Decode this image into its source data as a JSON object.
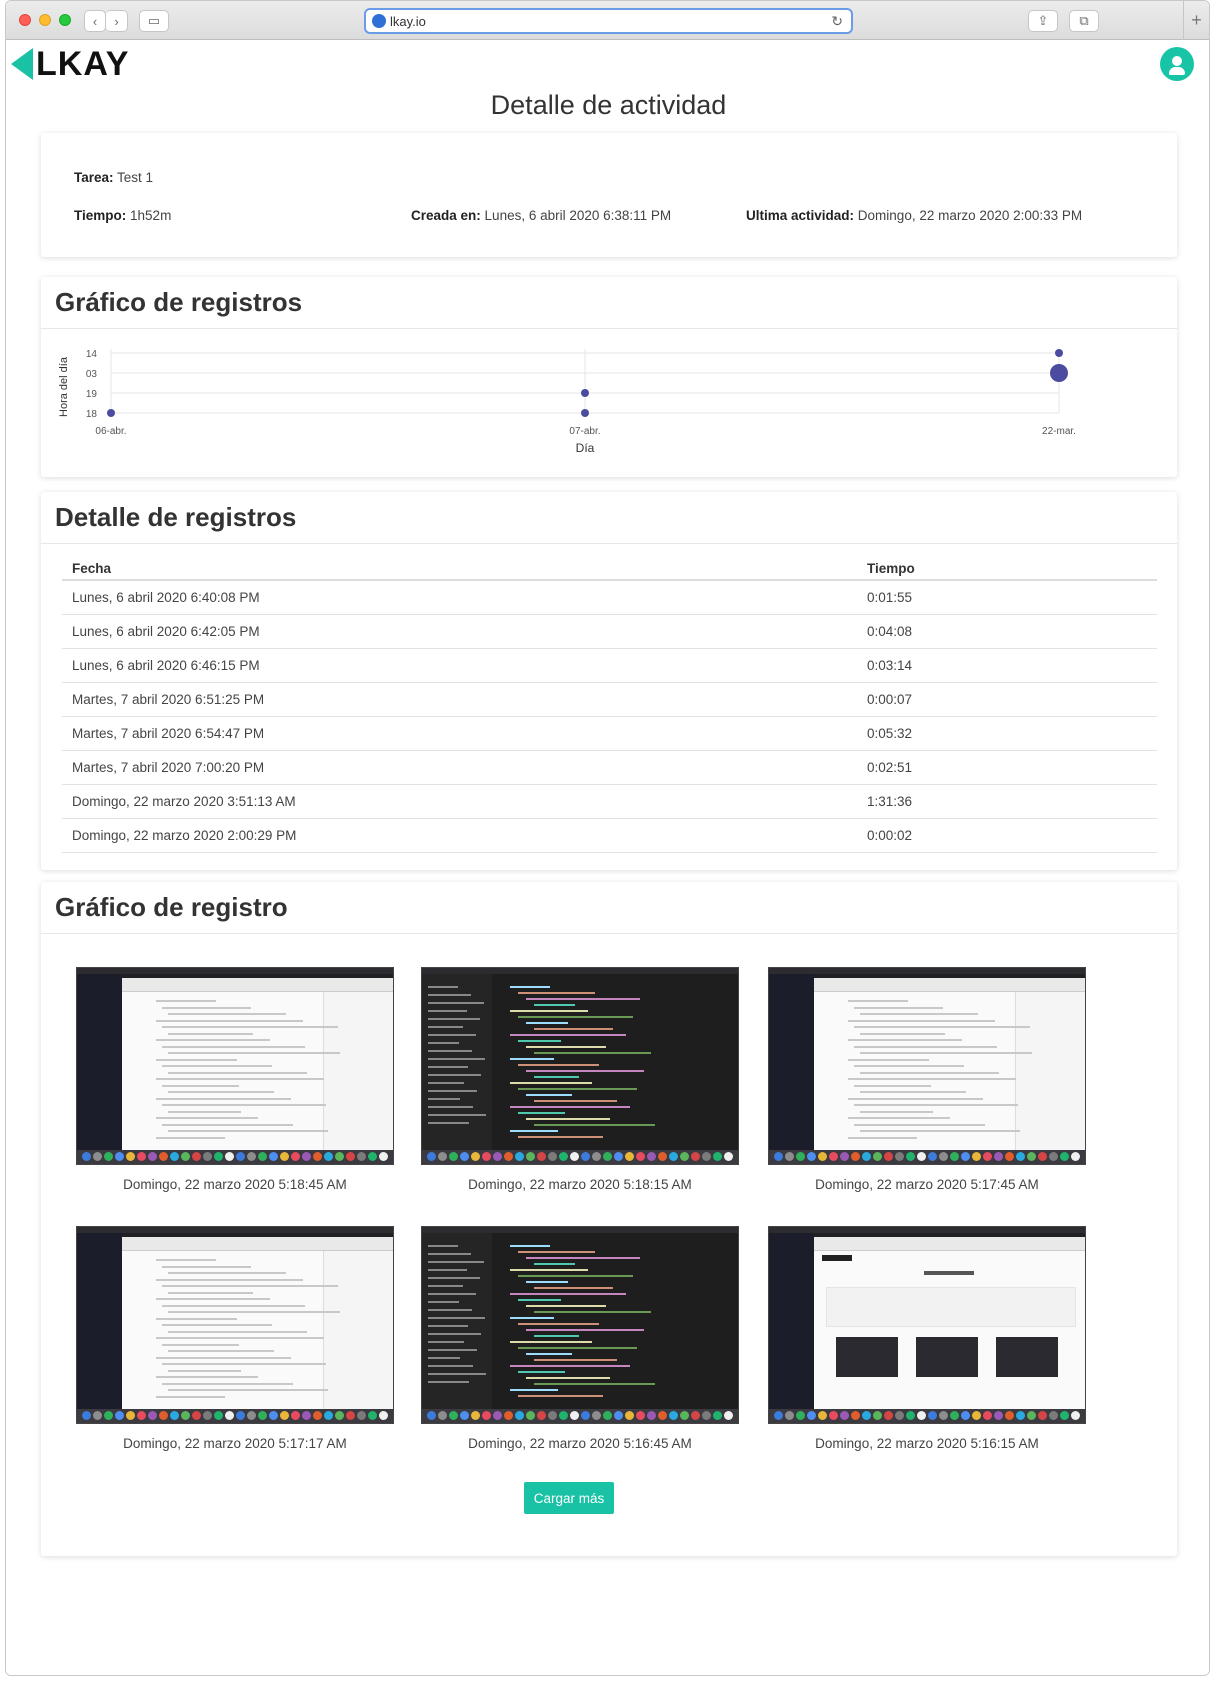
{
  "browser": {
    "url": "lkay.io"
  },
  "header": {
    "logo_text": "LKAY",
    "page_title": "Detalle de actividad"
  },
  "summary": {
    "task_label": "Tarea:",
    "task_value": "Test 1",
    "time_label": "Tiempo:",
    "time_value": "1h52m",
    "created_label": "Creada en:",
    "created_value": "Lunes, 6 abril 2020 6:38:11 PM",
    "last_label": "Ultima actividad:",
    "last_value": "Domingo, 22 marzo 2020 2:00:33 PM"
  },
  "chart_section": {
    "title": "Gráfico de registros"
  },
  "chart_data": {
    "type": "scatter",
    "xlabel": "Día",
    "ylabel": "Hora del día",
    "x_categories": [
      "06-abr.",
      "07-abr.",
      "22-mar."
    ],
    "y_categories": [
      "14",
      "03",
      "19",
      "18"
    ],
    "points": [
      {
        "x": "06-abr.",
        "y": "18",
        "size": 1
      },
      {
        "x": "07-abr.",
        "y": "19",
        "size": 1
      },
      {
        "x": "07-abr.",
        "y": "18",
        "size": 1
      },
      {
        "x": "22-mar.",
        "y": "14",
        "size": 1
      },
      {
        "x": "22-mar.",
        "y": "03",
        "size": 3
      }
    ],
    "grid": true,
    "color": "#4b4ba0"
  },
  "records_section": {
    "title": "Detalle de registros",
    "columns": [
      "Fecha",
      "Tiempo"
    ],
    "rows": [
      [
        "Lunes, 6 abril 2020 6:40:08 PM",
        "0:01:55"
      ],
      [
        "Lunes, 6 abril 2020 6:42:05 PM",
        "0:04:08"
      ],
      [
        "Lunes, 6 abril 2020 6:46:15 PM",
        "0:03:14"
      ],
      [
        "Martes, 7 abril 2020 6:51:25 PM",
        "0:00:07"
      ],
      [
        "Martes, 7 abril 2020 6:54:47 PM",
        "0:05:32"
      ],
      [
        "Martes, 7 abril 2020 7:00:20 PM",
        "0:02:51"
      ],
      [
        "Domingo, 22 marzo 2020 3:51:13 AM",
        "1:31:36"
      ],
      [
        "Domingo, 22 marzo 2020 2:00:29 PM",
        "0:00:02"
      ]
    ]
  },
  "screenshots_section": {
    "title": "Gráfico de registro",
    "items": [
      {
        "label": "Domingo, 22 marzo 2020 5:18:45 AM",
        "kind": "browser"
      },
      {
        "label": "Domingo, 22 marzo 2020 5:18:15 AM",
        "kind": "code"
      },
      {
        "label": "Domingo, 22 marzo 2020 5:17:45 AM",
        "kind": "browser"
      },
      {
        "label": "Domingo, 22 marzo 2020 5:17:17 AM",
        "kind": "browser"
      },
      {
        "label": "Domingo, 22 marzo 2020 5:16:45 AM",
        "kind": "code"
      },
      {
        "label": "Domingo, 22 marzo 2020 5:16:15 AM",
        "kind": "lkay"
      }
    ],
    "load_more": "Cargar más"
  },
  "colors": {
    "accent": "#19c2a4",
    "chart_points": "#4b4ba0"
  }
}
